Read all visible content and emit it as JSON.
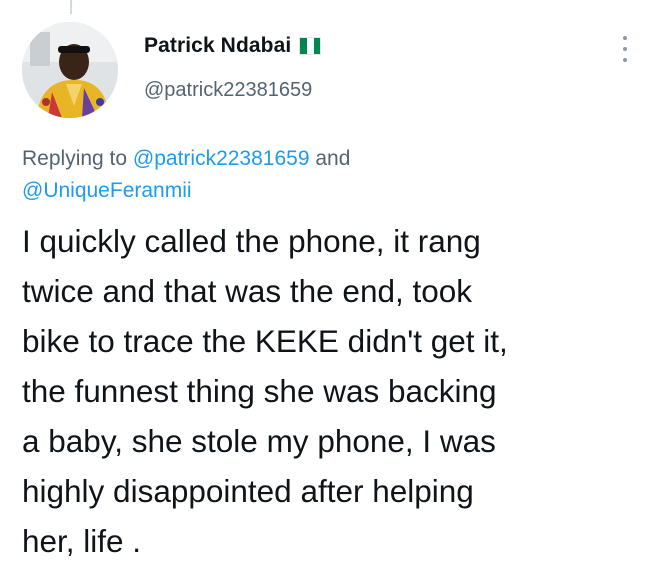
{
  "author": {
    "display_name": "Patrick Ndabai",
    "handle": "@patrick22381659",
    "flag_emoji": "🇳🇬",
    "avatar_icon": "profile-photo"
  },
  "reply_context": {
    "prefix": "Replying to ",
    "mentions": [
      "@patrick22381659",
      "@UniqueFeranmii"
    ],
    "joiner": " and"
  },
  "tweet": {
    "lines": [
      "I quickly called the phone, it rang",
      "twice and that was the end, took",
      "bike to trace the KEKE didn't get it,",
      "the funnest thing she was backing",
      "a baby, she stole my phone, I was",
      "highly disappointed after helping",
      "her, life ."
    ]
  },
  "icons": {
    "more": "more-vertical-icon",
    "flag": "nigeria-flag-icon"
  },
  "colors": {
    "text": "#0f1419",
    "secondary": "#536471",
    "link": "#1d9bf0",
    "flag_green": "#008751",
    "flag_white": "#ffffff"
  }
}
